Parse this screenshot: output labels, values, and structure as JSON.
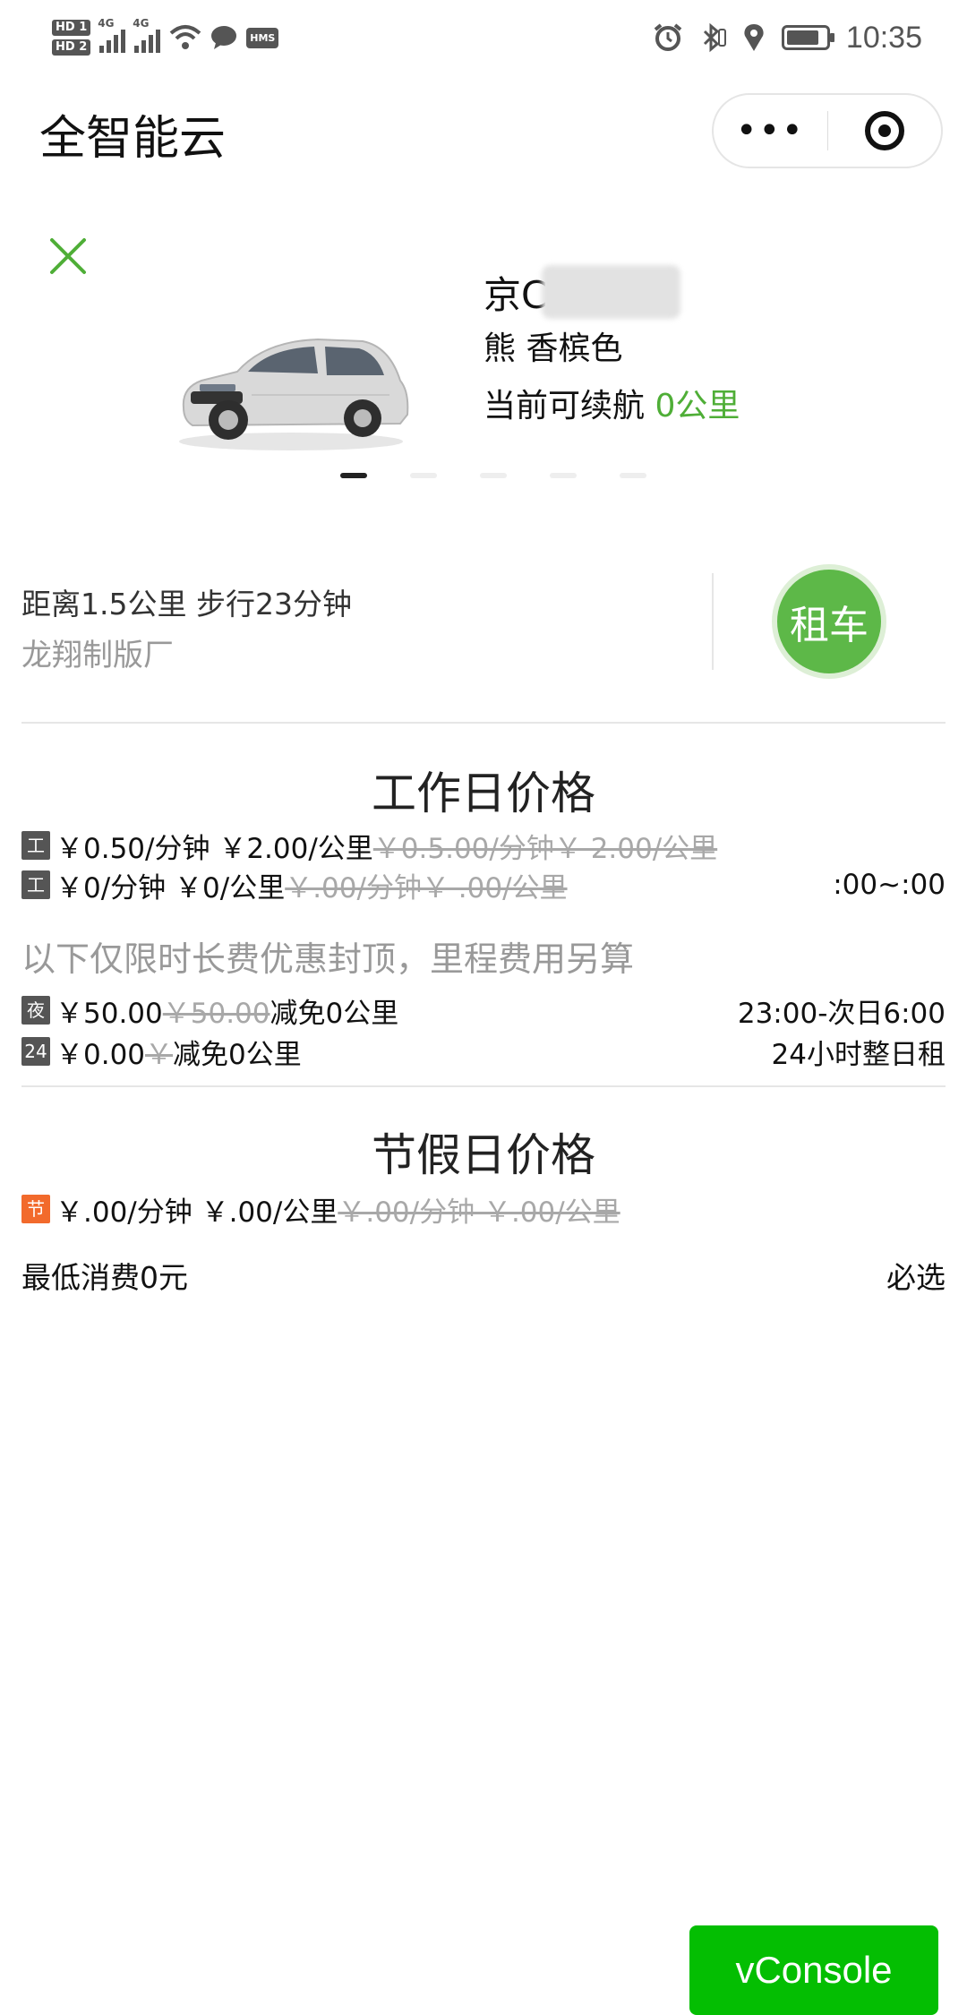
{
  "status_bar": {
    "hd1": "HD 1",
    "hd2": "HD 2",
    "net1": "4G",
    "net2": "4G",
    "hms": "HMS",
    "time": "10:35"
  },
  "header": {
    "title": "全智能云"
  },
  "car": {
    "plate_visible": "京C",
    "color_label": "熊 香槟色",
    "range_label": "当前可续航",
    "range_value": "0公里",
    "carousel_count": 5,
    "carousel_active": 0
  },
  "location": {
    "distance_text": "距离1.5公里 步行23分钟",
    "station_name": "龙翔制版厂",
    "rent_button": "租车"
  },
  "workday": {
    "title": "工作日价格",
    "rows": [
      {
        "tag": "工",
        "price": "￥0.50/分钟 ￥2.00/公里",
        "orig": "￥0.5.00/分钟￥ 2.00/公里",
        "right": ""
      },
      {
        "tag": "工",
        "price": "￥0/分钟 ￥0/公里",
        "orig": "￥.00/分钟￥ .00/公里",
        "right": ":00~:00"
      }
    ],
    "note": "以下仅限时长费优惠封顶，里程费用另算",
    "caps": [
      {
        "tag": "夜",
        "price": "￥50.00",
        "orig": "￥50.00",
        "suffix": "减免0公里",
        "right": "23:00-次日6:00"
      },
      {
        "tag": "24",
        "price": "￥0.00",
        "orig": "￥",
        "suffix": "减免0公里",
        "right": "24小时整日租"
      }
    ]
  },
  "holiday": {
    "title": "节假日价格",
    "rows": [
      {
        "tag": "节",
        "price": "￥.00/分钟 ￥.00/公里",
        "orig": "￥.00/分钟 ￥.00/公里"
      }
    ],
    "min_charge": "最低消费0元",
    "required": "必选"
  },
  "debug": {
    "vconsole_label": "vConsole",
    "accent_color": "#04be02"
  },
  "colors": {
    "brand_green": "#5db848",
    "range_green": "#4fae37",
    "holiday_tag": "#f26a2c"
  }
}
